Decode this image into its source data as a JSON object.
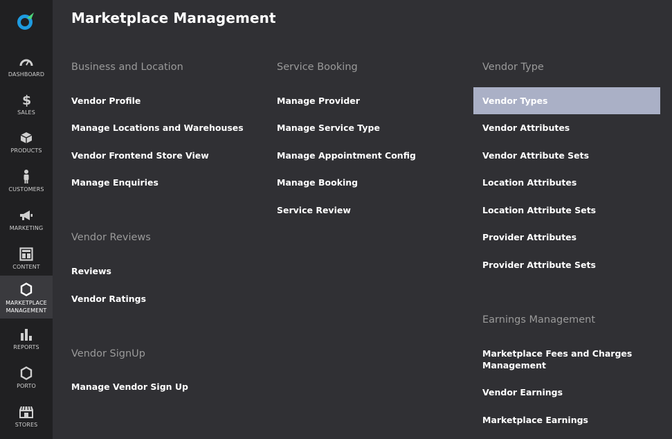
{
  "sidebar": {
    "items": [
      {
        "label": "DASHBOARD",
        "icon": "gauge-icon"
      },
      {
        "label": "SALES",
        "icon": "dollar-icon"
      },
      {
        "label": "PRODUCTS",
        "icon": "box-icon"
      },
      {
        "label": "CUSTOMERS",
        "icon": "person-icon"
      },
      {
        "label": "MARKETING",
        "icon": "megaphone-icon"
      },
      {
        "label": "CONTENT",
        "icon": "layout-icon"
      },
      {
        "label": "MARKETPLACE\nMANAGEMENT",
        "icon": "hexagon-icon",
        "active": true
      },
      {
        "label": "REPORTS",
        "icon": "bar-chart-icon"
      },
      {
        "label": "PORTO",
        "icon": "hexagon-icon"
      },
      {
        "label": "STORES",
        "icon": "storefront-icon"
      }
    ]
  },
  "main": {
    "title": "Marketplace Management",
    "columns": [
      {
        "sections": [
          {
            "title": "Business and Location",
            "links": [
              "Vendor Profile",
              "Manage Locations and Warehouses",
              "Vendor Frontend Store View",
              "Manage Enquiries"
            ]
          },
          {
            "title": "Vendor Reviews",
            "links": [
              "Reviews",
              "Vendor Ratings"
            ]
          },
          {
            "title": "Vendor SignUp",
            "links": [
              "Manage Vendor Sign Up"
            ]
          }
        ]
      },
      {
        "sections": [
          {
            "title": "Service Booking",
            "links": [
              "Manage Provider",
              "Manage Service Type",
              "Manage Appointment Config",
              "Manage Booking",
              "Service Review"
            ]
          }
        ]
      },
      {
        "sections": [
          {
            "title": "Vendor Type",
            "links": [
              "Vendor Types",
              "Vendor Attributes",
              "Vendor Attribute Sets",
              "Location Attributes",
              "Location Attribute Sets",
              "Provider Attributes",
              "Provider Attribute Sets"
            ]
          },
          {
            "title": "Earnings Management",
            "links": [
              "Marketplace Fees and Charges Management",
              "Vendor Earnings",
              "Marketplace Earnings"
            ]
          }
        ]
      }
    ]
  },
  "colors": {
    "sidebar_bg": "#202022",
    "main_bg": "#303034",
    "active_bg": "#3a3a3e",
    "highlight_bg": "#aab0c6",
    "section_title": "#9a9a9a",
    "logo_accent": "#1e9be0",
    "logo_green": "#4cd37a"
  }
}
